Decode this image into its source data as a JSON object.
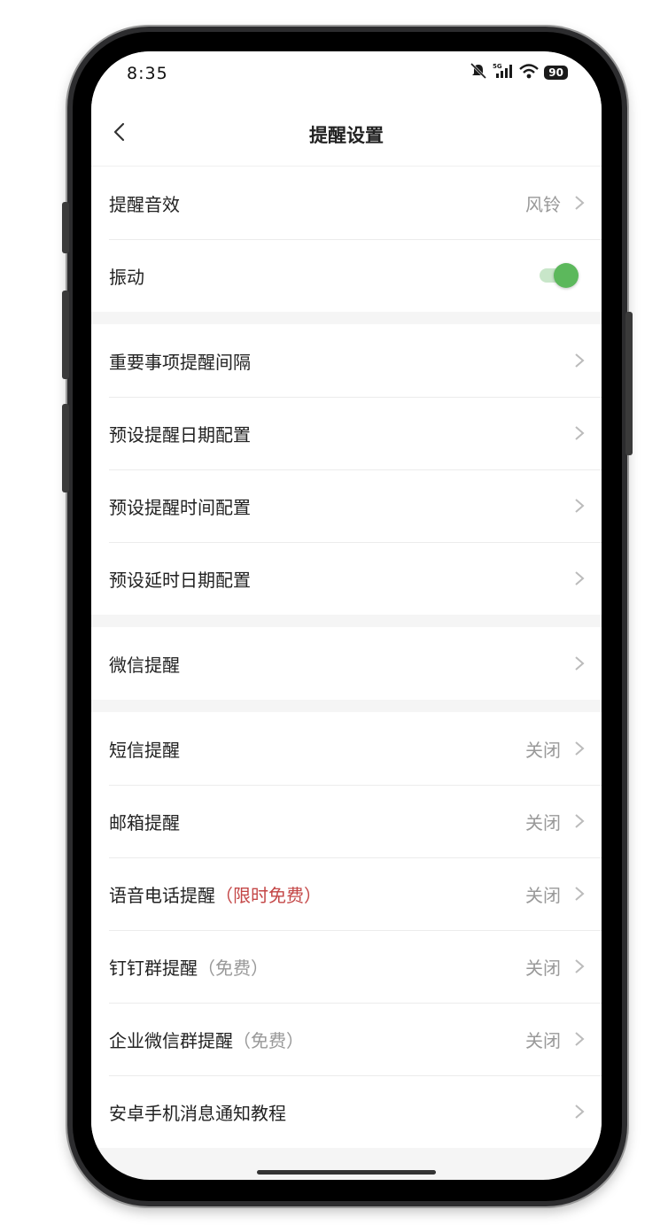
{
  "status_bar": {
    "time": "8:35",
    "battery": "90"
  },
  "header": {
    "title": "提醒设置"
  },
  "groups": [
    {
      "items": [
        {
          "label": "提醒音效",
          "value": "风铃"
        },
        {
          "label": "振动",
          "toggle_on": true
        }
      ]
    },
    {
      "items": [
        {
          "label": "重要事项提醒间隔"
        },
        {
          "label": "预设提醒日期配置"
        },
        {
          "label": "预设提醒时间配置"
        },
        {
          "label": "预设延时日期配置"
        }
      ]
    },
    {
      "items": [
        {
          "label": "微信提醒"
        }
      ]
    },
    {
      "items": [
        {
          "label": "短信提醒",
          "value": "关闭"
        },
        {
          "label": "邮箱提醒",
          "value": "关闭"
        },
        {
          "label": "语音电话提醒",
          "tag": "（限时免费）",
          "value": "关闭"
        },
        {
          "label": "钉钉群提醒",
          "tag": "（免费）",
          "value": "关闭"
        },
        {
          "label": "企业微信群提醒",
          "tag": "（免费）",
          "value": "关闭"
        },
        {
          "label": "安卓手机消息通知教程"
        }
      ]
    }
  ],
  "colors": {
    "accent": "#5cb85c",
    "promo_red": "#c44747",
    "secondary_text": "#999999"
  }
}
